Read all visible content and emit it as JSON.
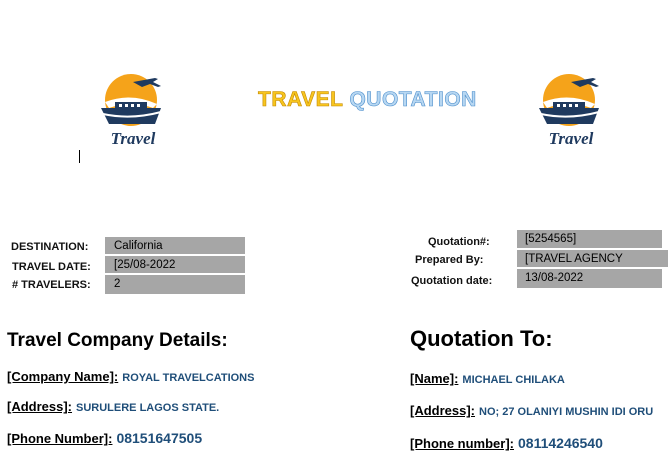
{
  "title": {
    "word1": "TRAVEL",
    "word2": "QUOTATION"
  },
  "logo": {
    "text": "Travel",
    "colors": {
      "sun": "#f5a31a",
      "ship": "#1f3a5f",
      "text": "#1f3a5f"
    }
  },
  "trip": {
    "destination_label": "DESTINATION:",
    "destination_value": "California",
    "travel_date_label": "TRAVEL DATE:",
    "travel_date_value": "[25/08-2022",
    "travelers_label": "# TRAVELERS:",
    "travelers_value": "2"
  },
  "quote": {
    "number_label": "Quotation#:",
    "number_value": "[5254565]",
    "prepared_label": "Prepared By:",
    "prepared_value": "[TRAVEL AGENCY",
    "date_label": "Quotation date:",
    "date_value": "13/08-2022"
  },
  "company": {
    "heading": "Travel Company Details:",
    "name_key": "[Company Name]:",
    "name_value": "ROYAL TRAVELCATIONS",
    "address_key": "[Address]:",
    "address_value": "SURULERE LAGOS STATE.",
    "phone_key": "[Phone Number]:",
    "phone_value": "08151647505"
  },
  "recipient": {
    "heading": "Quotation To:",
    "name_key": "[Name]:",
    "name_value": "MICHAEL CHILAKA",
    "address_key": "[Address]:",
    "address_value": "NO; 27 OLANIYI MUSHIN IDI ORU",
    "phone_key": "[Phone number]:",
    "phone_value": "08114246540"
  }
}
